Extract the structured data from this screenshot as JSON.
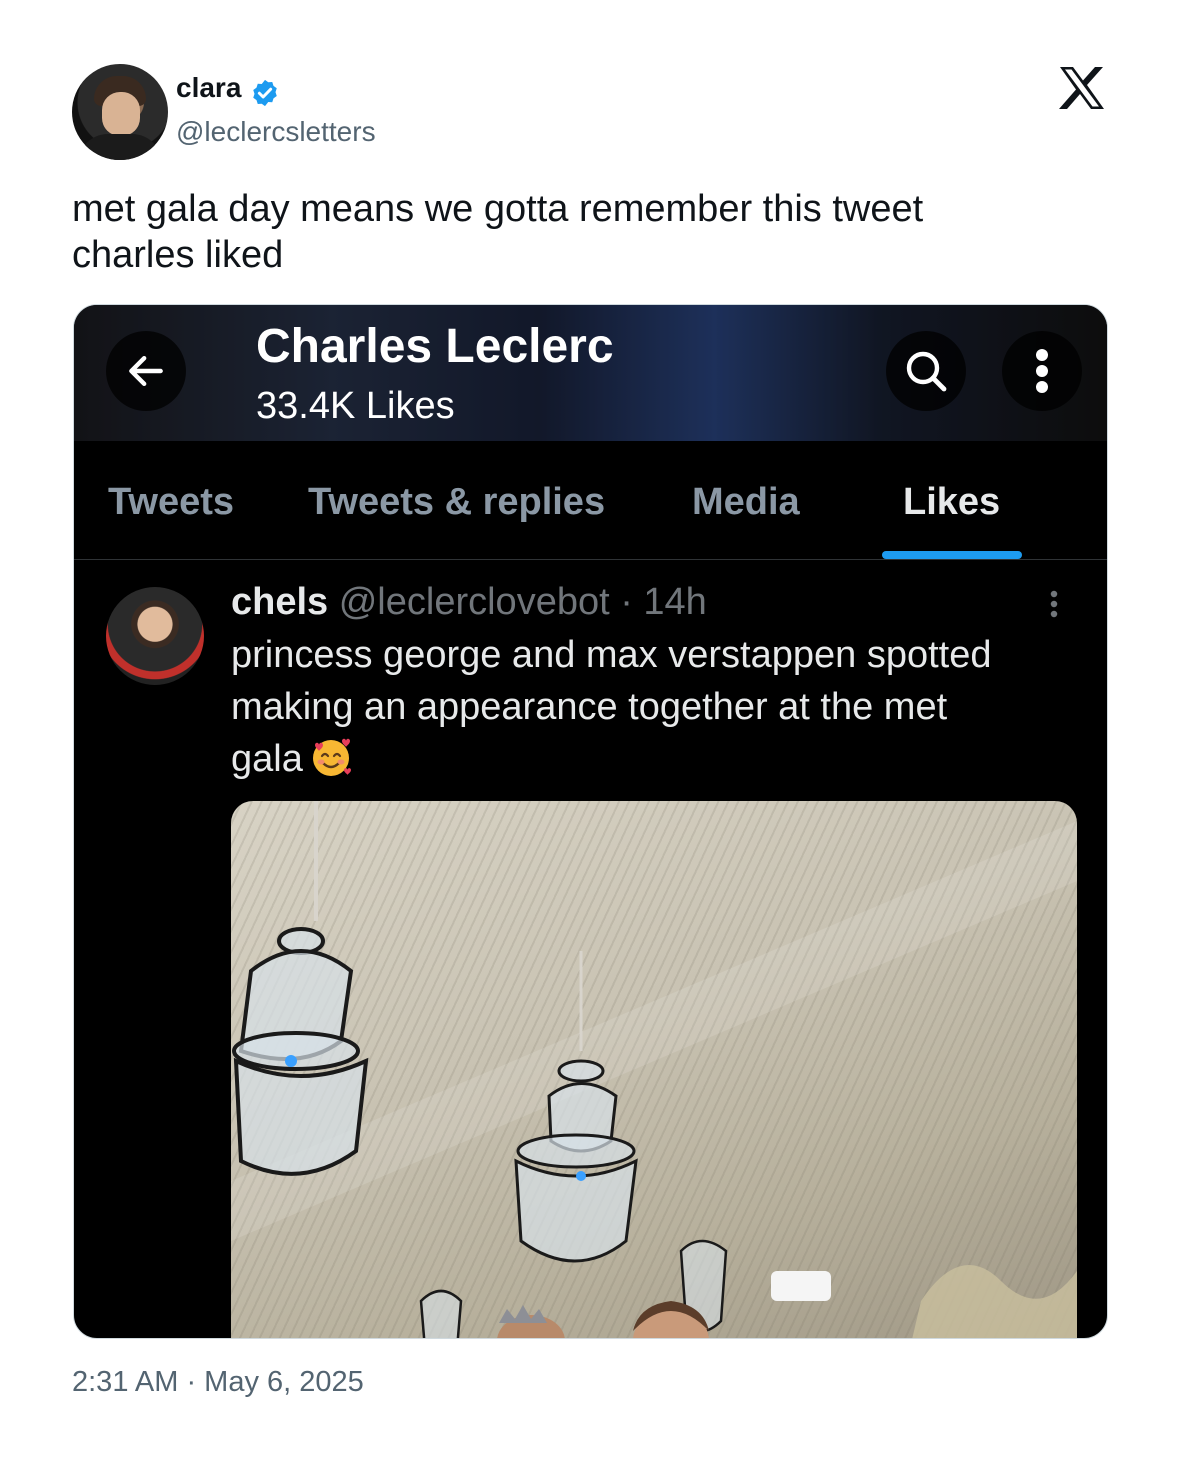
{
  "author": {
    "display_name": "clara",
    "handle": "@leclercsletters",
    "avatar_icon": "avatar",
    "verified_icon": "verified-badge-icon",
    "verified_color": "#1d9bf0"
  },
  "platform_icon": "x-logo-icon",
  "tweet": {
    "text_lines": [
      "met gala day means we gotta remember this tweet",
      "charles liked"
    ],
    "timestamp": "2:31 AM · May 6, 2025"
  },
  "screenshot": {
    "header": {
      "title": "Charles Leclerc",
      "subtitle": "33.4K Likes",
      "back_icon": "back-arrow-icon",
      "search_icon": "search-icon",
      "more_icon": "more-vertical-icon"
    },
    "tabs": [
      {
        "label": "Tweets",
        "active": false
      },
      {
        "label": "Tweets & replies",
        "active": false
      },
      {
        "label": "Media",
        "active": false
      },
      {
        "label": "Likes",
        "active": true
      }
    ],
    "accent": "#1d9bf0",
    "liked_tweet": {
      "name": "chels",
      "meta": " @leclerclovebot · 14h",
      "text_lines": [
        "princess george and max verstappen spotted",
        "making an appearance together at the met",
        "gala"
      ],
      "emoji_icon": "smiling-face-with-hearts-icon",
      "photo": "chandelier-ceiling-photo"
    }
  }
}
